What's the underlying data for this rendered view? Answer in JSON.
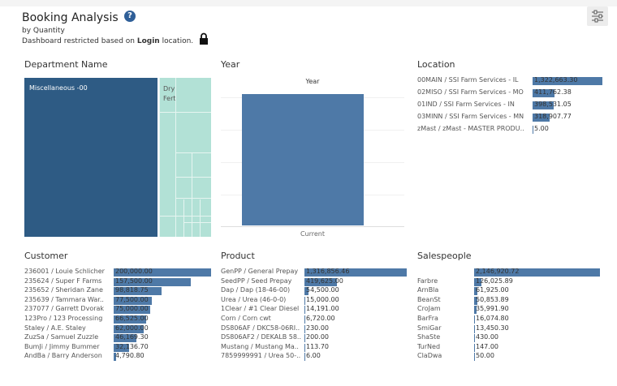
{
  "header": {
    "title": "Booking Analysis",
    "help_icon": "?",
    "subtitle": "by Quantity",
    "restriction_prefix": "Dashboard restricted based on ",
    "restriction_bold": "Login",
    "restriction_suffix": " location.",
    "lock_icon": "lock-icon",
    "filter_icon": "sliders-icon"
  },
  "department": {
    "title": "Department Name",
    "items": [
      {
        "label": "Miscellaneous -00"
      },
      {
        "label": "Dry"
      },
      {
        "label": "Fert"
      }
    ]
  },
  "year": {
    "title": "Year",
    "column_header": "Year",
    "bar_label": "Current"
  },
  "location": {
    "title": "Location",
    "rows": [
      {
        "label": "00MAIN / SSI Farm Services - IL",
        "value": "1,322,663.30",
        "num": 1322663.3
      },
      {
        "label": "02MISO / SSI Farm Services - MO",
        "value": "411,762.38",
        "num": 411762.38
      },
      {
        "label": "01IND / SSI Farm Services - IN",
        "value": "398,531.05",
        "num": 398531.05
      },
      {
        "label": "03MINN / SSI Farm Services - MN",
        "value": "318,907.77",
        "num": 318907.77
      },
      {
        "label": "zMast / zMast - MASTER PRODU..",
        "value": "5.00",
        "num": 5.0
      }
    ]
  },
  "customer": {
    "title": "Customer",
    "rows": [
      {
        "label": "236001 / Louie Schlicher",
        "value": "200,000.00",
        "num": 200000
      },
      {
        "label": "235624 / Super F Farms",
        "value": "157,500.00",
        "num": 157500
      },
      {
        "label": "235652 / Sheridan Zane",
        "value": "98,818.75",
        "num": 98818.75
      },
      {
        "label": "235639 / Tammara War..",
        "value": "77,500.00",
        "num": 77500
      },
      {
        "label": "237077 / Garrett Dvorak",
        "value": "75,000.00",
        "num": 75000
      },
      {
        "label": "123Pro / 123 Processing",
        "value": "66,525.00",
        "num": 66525
      },
      {
        "label": "Staley / A.E. Staley",
        "value": "62,000.00",
        "num": 62000
      },
      {
        "label": "ZuzSa / Samuel Zuzzle",
        "value": "46,169.30",
        "num": 46169.3
      },
      {
        "label": "BumJi / Jimmy Bummer",
        "value": "32,136.70",
        "num": 32136.7
      },
      {
        "label": "AndBa / Barry Anderson",
        "value": "4,790.80",
        "num": 4790.8
      }
    ]
  },
  "product": {
    "title": "Product",
    "rows": [
      {
        "label": "GenPP / General Prepay",
        "value": "1,316,856.46",
        "num": 1316856.46
      },
      {
        "label": "SeedPP / Seed Prepay",
        "value": "419,625.00",
        "num": 419625
      },
      {
        "label": "Dap / Dap (18-46-00)",
        "value": "54,500.00",
        "num": 54500
      },
      {
        "label": "Urea / Urea (46-0-0)",
        "value": "15,000.00",
        "num": 15000
      },
      {
        "label": "1Clear / #1 Clear Diesel",
        "value": "14,191.00",
        "num": 14191
      },
      {
        "label": "Corn / Corn cwt",
        "value": "6,720.00",
        "num": 6720
      },
      {
        "label": "DS806AF / DKC58-06RI..",
        "value": "230.00",
        "num": 230
      },
      {
        "label": "DS806AF2 / DEKALB 58..",
        "value": "200.00",
        "num": 200
      },
      {
        "label": "Mustang / Mustang Ma..",
        "value": "113.70",
        "num": 113.7
      },
      {
        "label": "7859999991 / Urea 50-..",
        "value": "6.00",
        "num": 6
      }
    ]
  },
  "salespeople": {
    "title": "Salespeople",
    "rows": [
      {
        "label": "",
        "value": "2,146,920.72",
        "num": 2146920.72
      },
      {
        "label": "Farbre",
        "value": "126,025.89",
        "num": 126025.89
      },
      {
        "label": "ArnBla",
        "value": "61,925.00",
        "num": 61925
      },
      {
        "label": "BeanSt",
        "value": "50,853.89",
        "num": 50853.89
      },
      {
        "label": "CroJam",
        "value": "35,991.90",
        "num": 35991.9
      },
      {
        "label": "BarFra",
        "value": "16,074.80",
        "num": 16074.8
      },
      {
        "label": "SmiGar",
        "value": "13,450.30",
        "num": 13450.3
      },
      {
        "label": "ShaSte",
        "value": "430.00",
        "num": 430
      },
      {
        "label": "TurNed",
        "value": "147.00",
        "num": 147
      },
      {
        "label": "ClaDwa",
        "value": "50.00",
        "num": 50
      }
    ]
  }
}
